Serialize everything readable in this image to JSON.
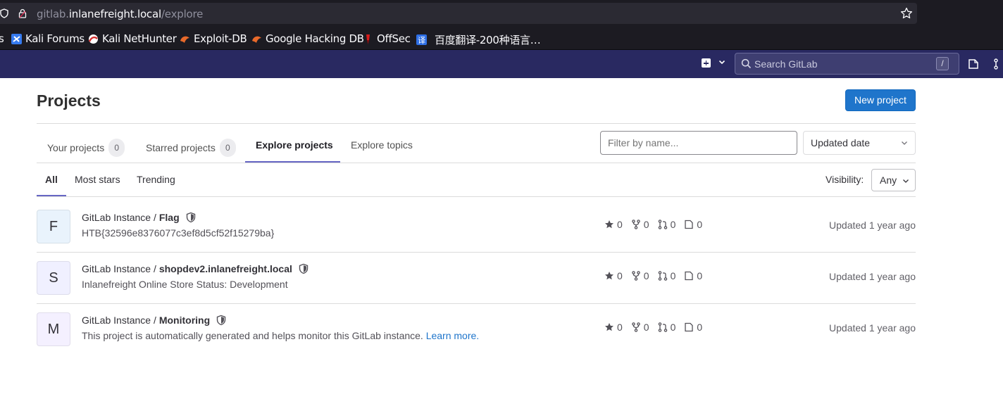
{
  "browser": {
    "url_host_prefix": "gitlab.",
    "url_host": "inlanefreight.local",
    "url_path": "/explore",
    "bookmarks": [
      {
        "label": "s"
      },
      {
        "label": "Kali Forums"
      },
      {
        "label": "Kali NetHunter"
      },
      {
        "label": "Exploit-DB"
      },
      {
        "label": "Google Hacking DB"
      },
      {
        "label": "OffSec"
      },
      {
        "label": "百度翻译-200种语言…"
      }
    ]
  },
  "nav": {
    "search_placeholder": "Search GitLab",
    "search_shortcut": "/"
  },
  "page": {
    "title": "Projects",
    "new_project_label": "New project"
  },
  "tabs": [
    {
      "label": "Your projects",
      "count": "0"
    },
    {
      "label": "Starred projects",
      "count": "0"
    },
    {
      "label": "Explore projects"
    },
    {
      "label": "Explore topics"
    }
  ],
  "filter_placeholder": "Filter by name...",
  "sort_selected": "Updated date",
  "subtabs": [
    {
      "label": "All"
    },
    {
      "label": "Most stars"
    },
    {
      "label": "Trending"
    }
  ],
  "visibility": {
    "label": "Visibility:",
    "selected": "Any"
  },
  "projects": [
    {
      "initial": "F",
      "avatar_color": "#e9f3fc",
      "namespace": "GitLab Instance /",
      "name": "Flag",
      "description": "HTB{32596e8376077c3ef8d5cf52f15279ba}",
      "stars": "0",
      "forks": "0",
      "merge_requests": "0",
      "issues": "0",
      "updated": "Updated 1 year ago"
    },
    {
      "initial": "S",
      "avatar_color": "#f0f0ff",
      "namespace": "GitLab Instance /",
      "name": "shopdev2.inlanefreight.local",
      "description": "Inlanefreight Online Store Status: Development",
      "stars": "0",
      "forks": "0",
      "merge_requests": "0",
      "issues": "0",
      "updated": "Updated 1 year ago"
    },
    {
      "initial": "M",
      "avatar_color": "#f4f0ff",
      "namespace": "GitLab Instance /",
      "name": "Monitoring",
      "description": "This project is automatically generated and helps monitor this GitLab instance.",
      "learn_more": "Learn more.",
      "stars": "0",
      "forks": "0",
      "merge_requests": "0",
      "issues": "0",
      "updated": "Updated 1 year ago"
    }
  ]
}
